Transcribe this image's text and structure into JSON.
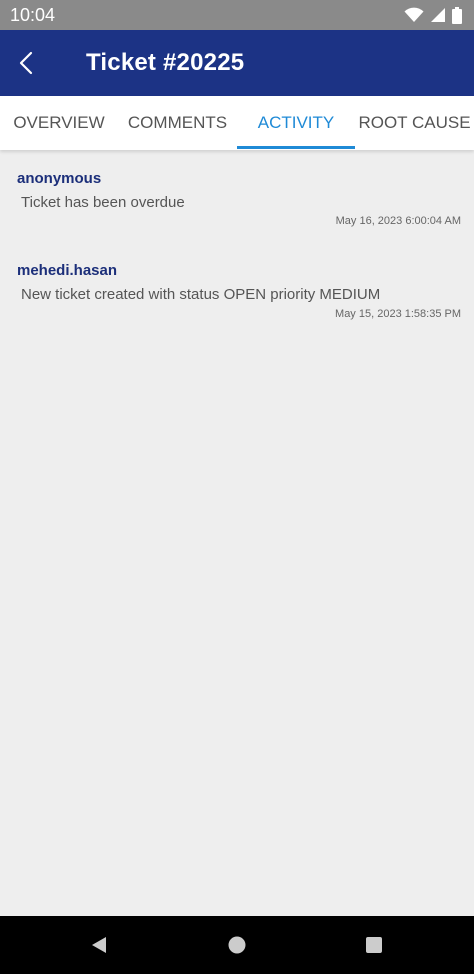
{
  "status_bar": {
    "time": "10:04",
    "icons": [
      "wifi-icon",
      "signal-icon",
      "battery-icon"
    ]
  },
  "app_bar": {
    "title": "Ticket #20225",
    "back_icon": "chevron-left-icon"
  },
  "tabs": [
    {
      "label": "OVERVIEW",
      "active": false
    },
    {
      "label": "COMMENTS",
      "active": false
    },
    {
      "label": "ACTIVITY",
      "active": true
    },
    {
      "label": "ROOT CAUSE",
      "active": false
    }
  ],
  "activities": [
    {
      "user": "anonymous",
      "message": "Ticket has been overdue",
      "timestamp": "May 16, 2023 6:00:04 AM"
    },
    {
      "user": "mehedi.hasan",
      "message": "New ticket created with status OPEN priority MEDIUM",
      "timestamp": "May 15, 2023 1:58:35 PM"
    }
  ],
  "nav_bar": {
    "icons": [
      "back-triangle-icon",
      "home-circle-icon",
      "recents-square-icon"
    ]
  },
  "colors": {
    "app_bar": "#1c3385",
    "accent": "#1f8ad6",
    "username": "#1c2f7a",
    "background": "#eeeeee"
  }
}
